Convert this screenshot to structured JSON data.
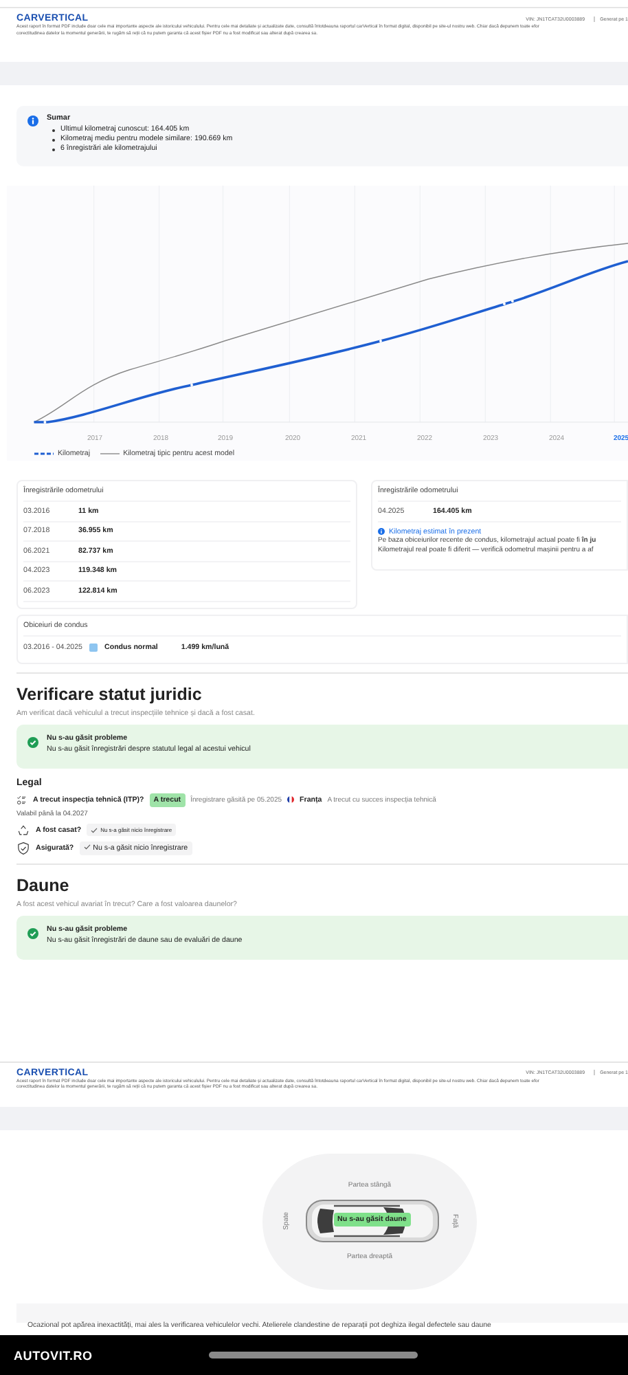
{
  "report_header": {
    "logo": "CARVERTICAL",
    "vin": "VIN: JN1TCAT32U0003889",
    "generated": "Generat pe 1",
    "disclaimer": "Acest raport în format PDF include doar cele mai importante aspecte ale istoricului vehiculului. Pentru cele mai detaliate și actualizate date, consultă întotdeauna raportul carVertical în format digital, disponibil pe site-ul nostru web. Chiar dacă depunem toate efor",
    "disclaimer_2": "corectitudinea datelor la momentul generării, te rugăm să reții că nu putem garanta că acest fișier PDF nu a fost modificat sau alterat după crearea sa."
  },
  "summary": {
    "title": "Sumar",
    "items": [
      "Ultimul kilometraj cunoscut: 164.405 km",
      "Kilometraj mediu pentru modele similare: 190.669 km",
      "6 înregistrări ale kilometrajului"
    ]
  },
  "mileage_chart": {
    "x_labels": [
      {
        "label": "2017",
        "selected": false
      },
      {
        "label": "2018",
        "selected": false
      },
      {
        "label": "2019",
        "selected": false
      },
      {
        "label": "2020",
        "selected": false
      },
      {
        "label": "2021",
        "selected": false
      },
      {
        "label": "2022",
        "selected": false
      },
      {
        "label": "2023",
        "selected": false
      },
      {
        "label": "2024",
        "selected": false
      },
      {
        "label": "2025",
        "selected": true
      }
    ],
    "legend": [
      {
        "kind": "recorded",
        "label": "Kilometraj"
      },
      {
        "kind": "typical",
        "label": "Kilometraj tipic pentru acest model"
      }
    ]
  },
  "odometer_records": {
    "title": "Înregistrările odometrului",
    "rows": [
      {
        "date": "03.2016",
        "km": "11 km"
      },
      {
        "date": "07.2018",
        "km": "36.955 km"
      },
      {
        "date": "06.2021",
        "km": "82.737 km"
      },
      {
        "date": "04.2023",
        "km": "119.348 km"
      },
      {
        "date": "06.2023",
        "km": "122.814 km"
      }
    ]
  },
  "odometer_latest": {
    "title": "Înregistrările odometrului",
    "rows": [
      {
        "date": "04.2025",
        "km": "164.405 km"
      }
    ],
    "estimate_link": "Kilometraj estimat în prezent",
    "estimate_text": "Pe baza obiceiurilor recente de condus, kilometrajul actual poate fi **în ju**",
    "estimate_text_2": "Kilometrajul real poate fi diferit — verifică odometrul mașinii pentru a af"
  },
  "driving_habits": {
    "title": "Obiceiuri de condus",
    "period": "03.2016 - 04.2025",
    "style": "Condus normal",
    "color": "#8ec5f0",
    "rate": "1.499 km/lună"
  },
  "legal_status": {
    "title": "Verificare statut juridic",
    "subtitle": "Am verificat dacă vehiculul a trecut inspecțiile tehnice și dacă a fost casat.",
    "status": {
      "title": "Nu s-au găsit probleme",
      "text": "Nu s-au găsit înregistrări despre statutul legal al acestui vehicul"
    },
    "legal_title": "Legal",
    "checks": [
      {
        "kind": "inspection",
        "question": "A trecut inspecția tehnică (ITP)?",
        "badge": "A trecut",
        "found": "Înregistrare găsită pe 05.2025",
        "country": "Franța",
        "note": "A trecut cu succes inspecția tehnică",
        "validity": "Valabil până la 04.2027"
      },
      {
        "kind": "scrapped",
        "question": "A fost casat?",
        "badge": "Nu s-a găsit nicio înregistrare"
      },
      {
        "kind": "insured",
        "question": "Asigurată?",
        "badge": "Nu s-a găsit nicio înregistrare"
      }
    ]
  },
  "damage": {
    "title": "Daune",
    "subtitle": "A fost acest vehicul avariat în trecut? Care a fost valoarea daunelor?",
    "status": {
      "title": "Nu s-au găsit probleme",
      "text": "Nu s-au găsit înregistrări de daune sau de evaluări de daune"
    }
  },
  "report_footer": {
    "logo": "CARVERTICAL",
    "vin": "VIN: JN1TCAT32U0003889",
    "generated": "Generat pe 1",
    "disclaimer": "Acest raport în format PDF include doar cele mai importante aspecte ale istoricului vehiculului. Pentru cele mai detaliate și actualizate date, consultă întotdeauna raportul carVertical în format digital, disponibil pe site-ul nostru web. Chiar dacă depunem toate efor",
    "disclaimer_2": "corectitudinea datelor la momentul generării, te rugăm să reții că nu putem garanta că acest fișier PDF nu a fost modificat sau alterat după crearea sa."
  },
  "car_diagram": {
    "left": "Partea stângă",
    "right": "Partea dreaptă",
    "rear": "Spate",
    "front": "Față",
    "status": "Nu s-au găsit daune"
  },
  "notice": "Ocazional pot apărea inexactități, mai ales la verificarea vehiculelor vechi. Atelierele clandestine de reparații pot deghiza ilegal defectele sau daune",
  "app_bar": {
    "logo": "AUTOVIT.RO"
  }
}
